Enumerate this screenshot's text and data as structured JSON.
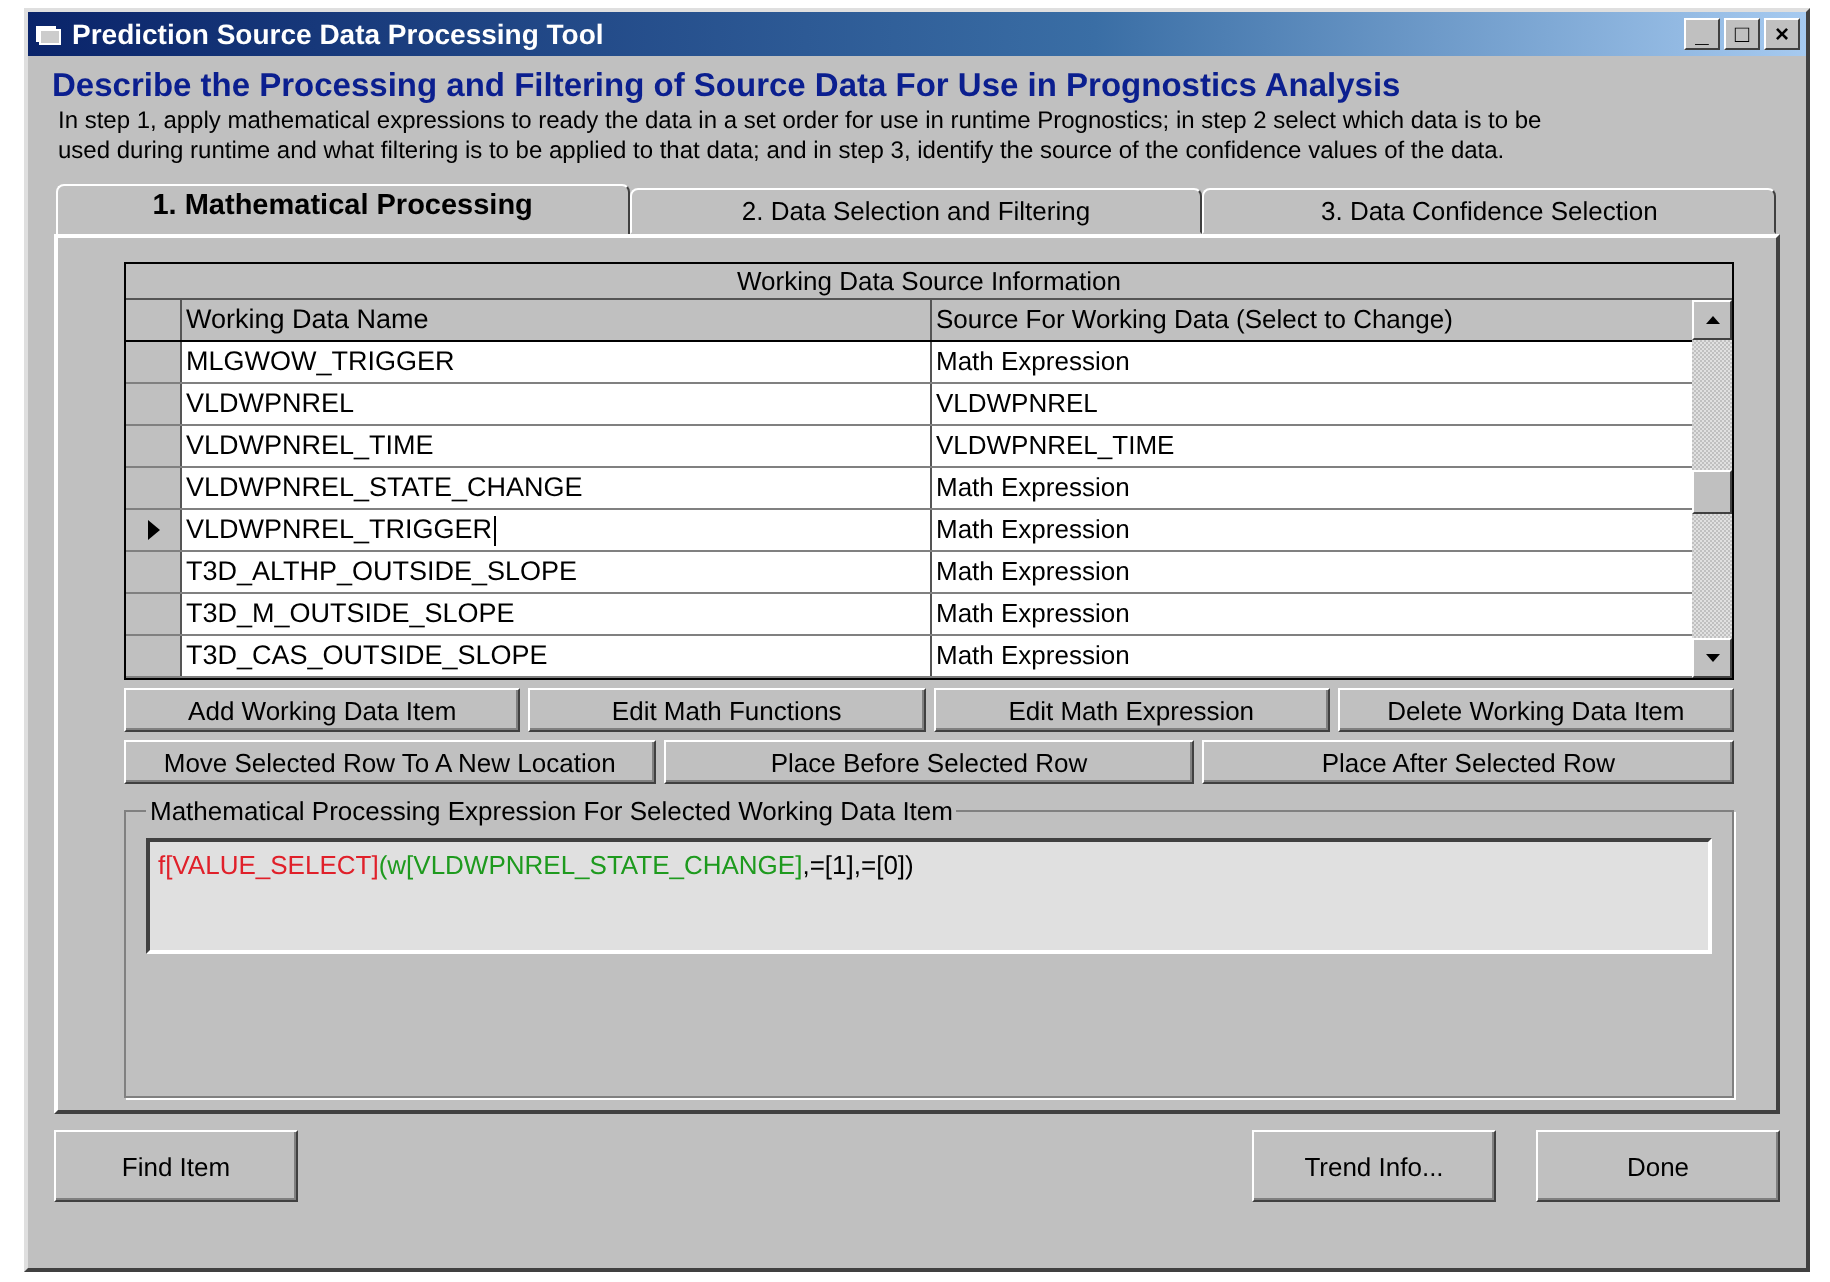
{
  "window": {
    "title": "Prediction Source Data Processing Tool",
    "controls": [
      "_",
      "□",
      "×"
    ]
  },
  "heading": "Describe the Processing and Filtering of Source Data For Use in Prognostics Analysis",
  "description": "In step 1, apply mathematical expressions to ready the data in a set order for use in runtime Prognostics; in step 2 select which data is to be used during runtime and what filtering is to be applied to that data; and in step 3, identify the source of the confidence values of the data.",
  "tabs": [
    {
      "label": "1. Mathematical Processing",
      "selected": true
    },
    {
      "label": "2. Data Selection and Filtering",
      "selected": false
    },
    {
      "label": "3. Data Confidence Selection",
      "selected": false
    }
  ],
  "grid": {
    "caption": "Working Data Source Information",
    "columns": [
      "Working Data Name",
      "Source For Working Data (Select to Change)"
    ],
    "rows": [
      {
        "name": "MLGWOW_TRIGGER",
        "source": "Math Expression",
        "selected": false
      },
      {
        "name": "VLDWPNREL",
        "source": "VLDWPNREL",
        "selected": false
      },
      {
        "name": "VLDWPNREL_TIME",
        "source": "VLDWPNREL_TIME",
        "selected": false
      },
      {
        "name": "VLDWPNREL_STATE_CHANGE",
        "source": "Math Expression",
        "selected": false
      },
      {
        "name": "VLDWPNREL_TRIGGER",
        "source": "Math Expression",
        "selected": true
      },
      {
        "name": "T3D_ALTHP_OUTSIDE_SLOPE",
        "source": "Math Expression",
        "selected": false
      },
      {
        "name": "T3D_M_OUTSIDE_SLOPE",
        "source": "Math Expression",
        "selected": false
      },
      {
        "name": "T3D_CAS_OUTSIDE_SLOPE",
        "source": "Math Expression",
        "selected": false
      }
    ]
  },
  "button_rows": [
    [
      "Add Working Data Item",
      "Edit Math Functions",
      "Edit Math Expression",
      "Delete Working Data Item"
    ],
    [
      "Move Selected Row To A New Location",
      "Place Before Selected Row",
      "Place After Selected Row"
    ]
  ],
  "expression_group": {
    "title": "Mathematical Processing Expression For Selected Working Data Item",
    "segments": [
      {
        "text": "f[VALUE_SELECT]",
        "color": "#e0202a"
      },
      {
        "text": "(w[VLDWPNREL_STATE_CHANGE]",
        "color": "#1e9a1e"
      },
      {
        "text": ",=[1],=[0])",
        "color": "#000000"
      }
    ]
  },
  "footer_left": "Find Item",
  "footer_right": [
    "Trend Info...",
    "Done"
  ]
}
